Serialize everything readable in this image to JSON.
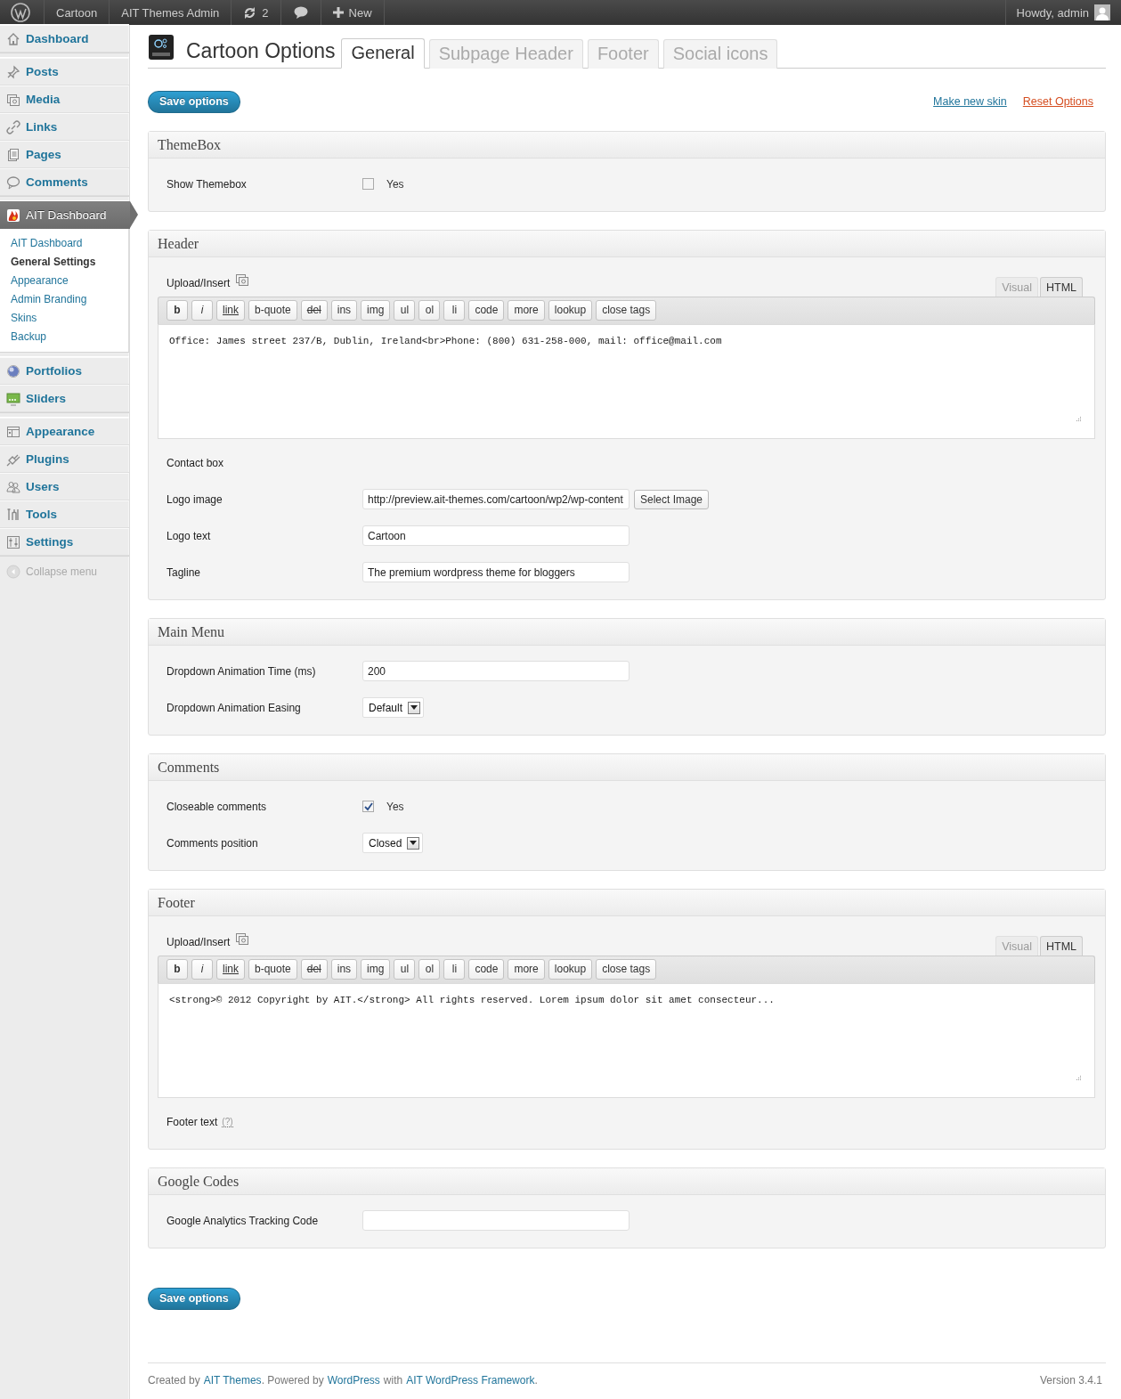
{
  "admin_bar": {
    "site": "Cartoon",
    "admin_link": "AIT Themes Admin",
    "updates": "2",
    "new": "New",
    "account": "Howdy, admin"
  },
  "sidebar": {
    "groups": [
      {
        "items": [
          {
            "label": "Dashboard",
            "selected": false
          }
        ]
      },
      {
        "items": [
          {
            "label": "Posts",
            "selected": false
          },
          {
            "label": "Media",
            "selected": false
          },
          {
            "label": "Links",
            "selected": false
          },
          {
            "label": "Pages",
            "selected": false
          },
          {
            "label": "Comments",
            "selected": false
          }
        ]
      },
      {
        "items": [
          {
            "label": "AIT Dashboard",
            "selected": true,
            "children": [
              {
                "label": "AIT Dashboard",
                "selected": false
              },
              {
                "label": "General Settings",
                "selected": true
              },
              {
                "label": "Appearance",
                "selected": false
              },
              {
                "label": "Admin Branding",
                "selected": false
              },
              {
                "label": "Skins",
                "selected": false
              },
              {
                "label": "Backup",
                "selected": false
              }
            ]
          }
        ]
      },
      {
        "items": [
          {
            "label": "Portfolios",
            "selected": false
          },
          {
            "label": "Sliders",
            "selected": false
          }
        ]
      },
      {
        "items": [
          {
            "label": "Appearance",
            "selected": false
          },
          {
            "label": "Plugins",
            "selected": false
          },
          {
            "label": "Users",
            "selected": false
          },
          {
            "label": "Tools",
            "selected": false
          },
          {
            "label": "Settings",
            "selected": false
          }
        ]
      }
    ],
    "collapse": "Collapse menu"
  },
  "page": {
    "title": "Cartoon Options",
    "tabs": [
      {
        "label": "General",
        "selected": true
      },
      {
        "label": "Subpage Header",
        "selected": false
      },
      {
        "label": "Footer",
        "selected": false
      },
      {
        "label": "Social icons",
        "selected": false
      }
    ],
    "save_button": "Save options",
    "make_skin": "Make new skin",
    "reset": "Reset Options"
  },
  "sections": [
    {
      "title": "ThemeBox",
      "fields": [
        {
          "kind": "checkbox",
          "label": "Show Themebox",
          "option": "Yes",
          "checked": false
        }
      ]
    },
    {
      "title": "Header",
      "fields": [
        {
          "kind": "editor",
          "label": "Upload/Insert",
          "tabs": [
            {
              "label": "Visual",
              "selected": false
            },
            {
              "label": "HTML",
              "selected": true
            }
          ],
          "buttons": [
            "b",
            "i",
            "link",
            "b-quote",
            "del",
            "ins",
            "img",
            "ul",
            "ol",
            "li",
            "code",
            "more",
            "lookup",
            "close tags"
          ],
          "value": "Office: James street 237/B, Dublin, Ireland<br>Phone: (800) 631-258-000, mail: office@mail.com"
        },
        {
          "kind": "heading",
          "label": "Contact box"
        },
        {
          "kind": "image",
          "label": "Logo image",
          "value": "http://preview.ait-themes.com/cartoon/wp2/wp-content",
          "button": "Select Image"
        },
        {
          "kind": "text",
          "label": "Logo text",
          "value": "Cartoon"
        },
        {
          "kind": "text",
          "label": "Tagline",
          "value": "The premium wordpress theme for bloggers"
        }
      ]
    },
    {
      "title": "Main Menu",
      "fields": [
        {
          "kind": "text",
          "label": "Dropdown Animation Time (ms)",
          "value": "200"
        },
        {
          "kind": "select",
          "label": "Dropdown Animation Easing",
          "value": "Default"
        }
      ]
    },
    {
      "title": "Comments",
      "fields": [
        {
          "kind": "checkbox",
          "label": "Closeable comments",
          "option": "Yes",
          "checked": true
        },
        {
          "kind": "select",
          "label": "Comments position",
          "value": "Closed"
        }
      ]
    },
    {
      "title": "Footer",
      "fields": [
        {
          "kind": "editor",
          "label": "Upload/Insert",
          "tabs": [
            {
              "label": "Visual",
              "selected": false
            },
            {
              "label": "HTML",
              "selected": true
            }
          ],
          "buttons": [
            "b",
            "i",
            "link",
            "b-quote",
            "del",
            "ins",
            "img",
            "ul",
            "ol",
            "li",
            "code",
            "more",
            "lookup",
            "close tags"
          ],
          "value": "<strong>© 2012 Copyright by AIT.</strong> All rights reserved. Lorem ipsum dolor sit amet consecteur..."
        },
        {
          "kind": "help",
          "label": "Footer text",
          "help": "(?)"
        }
      ]
    },
    {
      "title": "Google Codes",
      "fields": [
        {
          "kind": "text",
          "label": "Google Analytics Tracking Code"
        }
      ]
    }
  ],
  "bottom_save_button": "Save options",
  "footer": {
    "parts": [
      {
        "kind": "text",
        "text": "Created by"
      },
      {
        "kind": "link",
        "text": "AIT Themes"
      },
      {
        "kind": "text",
        "text": ". Powered by"
      },
      {
        "kind": "link",
        "text": "WordPress"
      },
      {
        "kind": "text",
        "text": "with"
      },
      {
        "kind": "link",
        "text": "AIT WordPress Framework"
      },
      {
        "kind": "text",
        "text": "."
      }
    ],
    "version": "Version 3.4.1"
  }
}
